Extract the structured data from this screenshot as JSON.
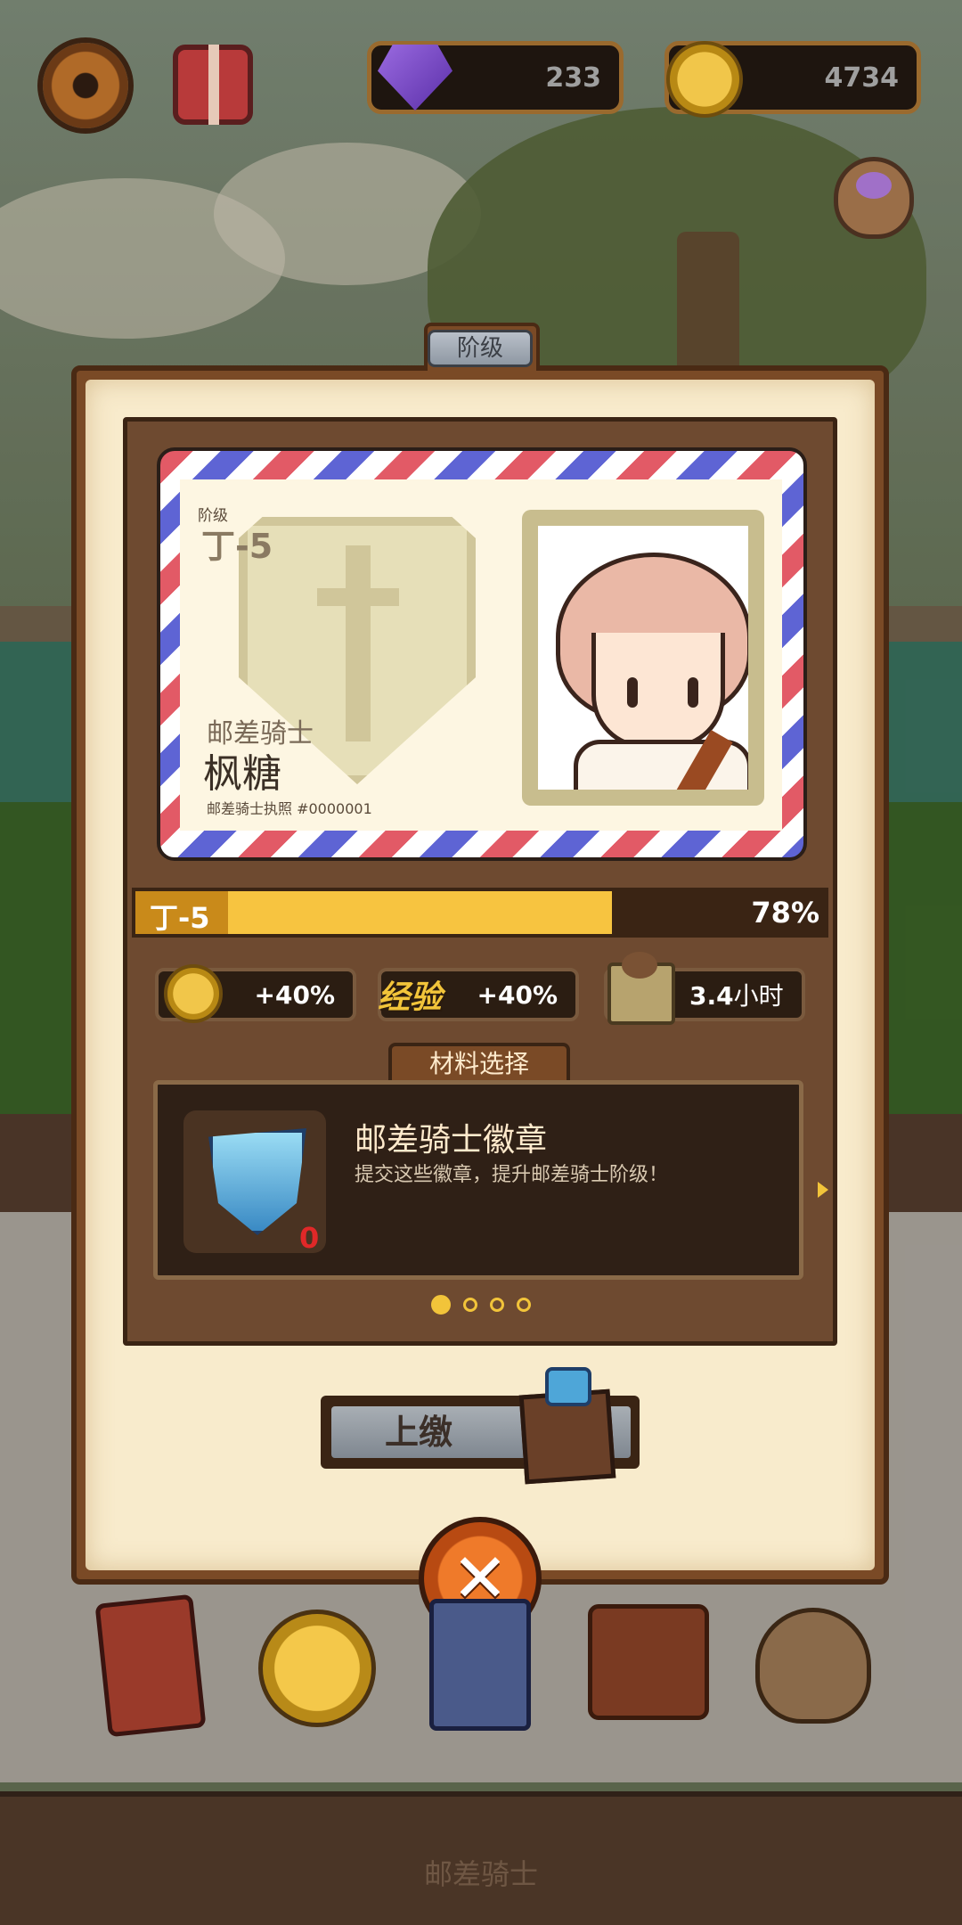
{
  "hud": {
    "gems": "233",
    "coins": "4734",
    "settings_icon": "gear-icon",
    "gift_icon": "gift-icon",
    "gem_icon": "purple-gem-icon",
    "coin_icon": "gold-coin-icon",
    "bag_icon": "loot-bag-icon"
  },
  "modal": {
    "tab_title": "阶级",
    "card": {
      "rank_label": "阶级",
      "rank_value": "丁-5",
      "role": "邮差骑士",
      "name": "枫糖",
      "license": "邮差骑士执照 #0000001",
      "emblem_icon": "sword-shield-emblem",
      "portrait_icon": "character-portrait"
    },
    "progress": {
      "label": "丁-5",
      "percent_text": "78%",
      "percent": 0.78
    },
    "stats": [
      {
        "icon": "gold-coin-icon",
        "value": "+40%"
      },
      {
        "icon_text": "经验",
        "value": "+40%"
      },
      {
        "icon": "crate-icon",
        "value_number": "3.4",
        "value_unit": "小时"
      }
    ],
    "materials": {
      "tab": "材料选择",
      "title": "邮差骑士徽章",
      "description": "提交这些徽章，提升邮差骑士阶级！",
      "count": "0",
      "icon": "knight-badge-icon",
      "page_dots": 4,
      "active_page": 1
    },
    "submit_label": "上缴",
    "close_icon": "close-x-icon"
  },
  "bottom_nav": {
    "items": [
      "book-icon",
      "star-medal-icon",
      "card-deck-icon",
      "satchel-icon",
      "loot-bag-icon"
    ],
    "title": "邮差骑士"
  },
  "colors": {
    "progress_fill": "#f7c440",
    "progress_left": "#c98a1a",
    "frame": "#7a4a26",
    "parchment": "#f8ebcc",
    "close": "#ef7a2a"
  }
}
